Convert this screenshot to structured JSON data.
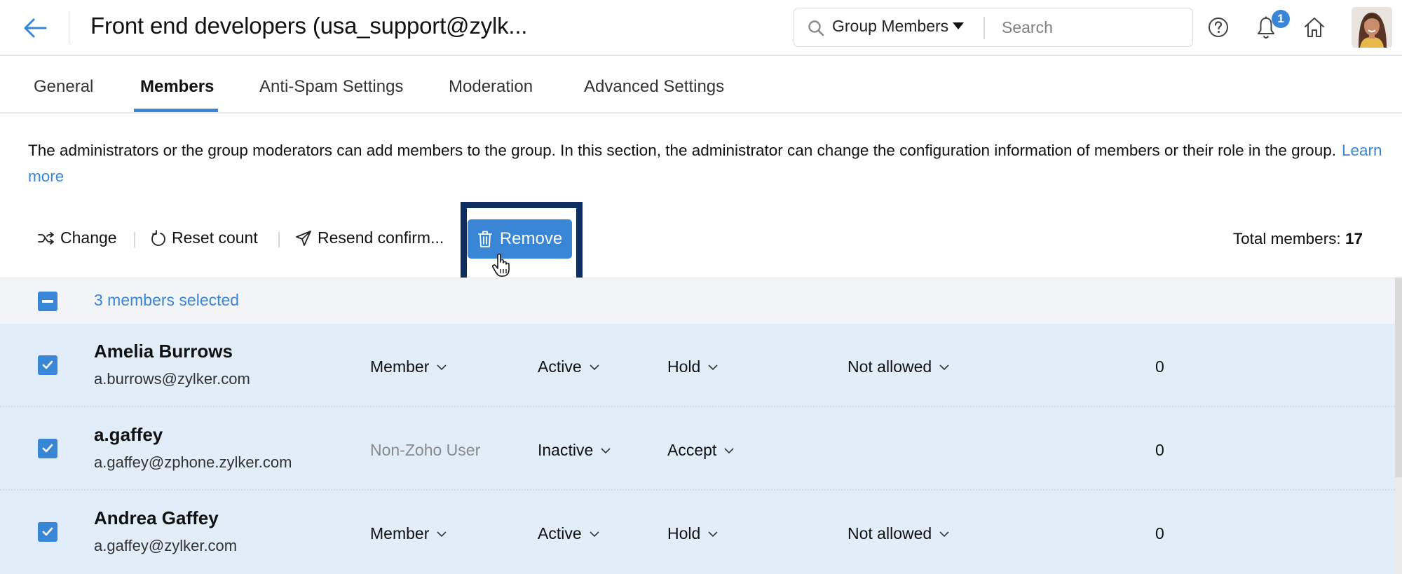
{
  "header": {
    "title": "Front end developers (usa_support@zylk...",
    "search": {
      "scope": "Group Members",
      "placeholder": "Search",
      "value": ""
    },
    "notifications_count": "1",
    "icons": [
      "back-arrow-icon",
      "search-icon",
      "help-icon",
      "bell-icon",
      "home-icon",
      "user-avatar"
    ]
  },
  "tabs": [
    {
      "label": "General",
      "active": false
    },
    {
      "label": "Members",
      "active": true
    },
    {
      "label": "Anti-Spam Settings",
      "active": false
    },
    {
      "label": "Moderation",
      "active": false
    },
    {
      "label": "Advanced Settings",
      "active": false
    }
  ],
  "description": {
    "text": "The administrators or the group moderators can add members to the group. In this section, the administrator can change the configuration information of members or their role in the group.",
    "link": "Learn more"
  },
  "toolbar": {
    "change_label": "Change",
    "reset_label": "Reset count",
    "resend_label": "Resend confirm...",
    "remove_label": "Remove",
    "total_label": "Total members:",
    "total_value": "17"
  },
  "selection": {
    "label": "3 members selected"
  },
  "accent_color": "#3a86d6",
  "members": [
    {
      "name": "Amelia Burrows",
      "email": "a.burrows@zylker.com",
      "role": "Member",
      "role_editable": true,
      "status": "Active",
      "moderation": "Hold",
      "posting": "Not allowed",
      "count": "0",
      "selected": true
    },
    {
      "name": "a.gaffey",
      "email": "a.gaffey@zphone.zylker.com",
      "role": "Non-Zoho User",
      "role_editable": false,
      "status": "Inactive",
      "moderation": "Accept",
      "posting": "",
      "count": "0",
      "selected": true
    },
    {
      "name": "Andrea Gaffey",
      "email": "a.gaffey@zylker.com",
      "role": "Member",
      "role_editable": true,
      "status": "Active",
      "moderation": "Hold",
      "posting": "Not allowed",
      "count": "0",
      "selected": true
    }
  ]
}
